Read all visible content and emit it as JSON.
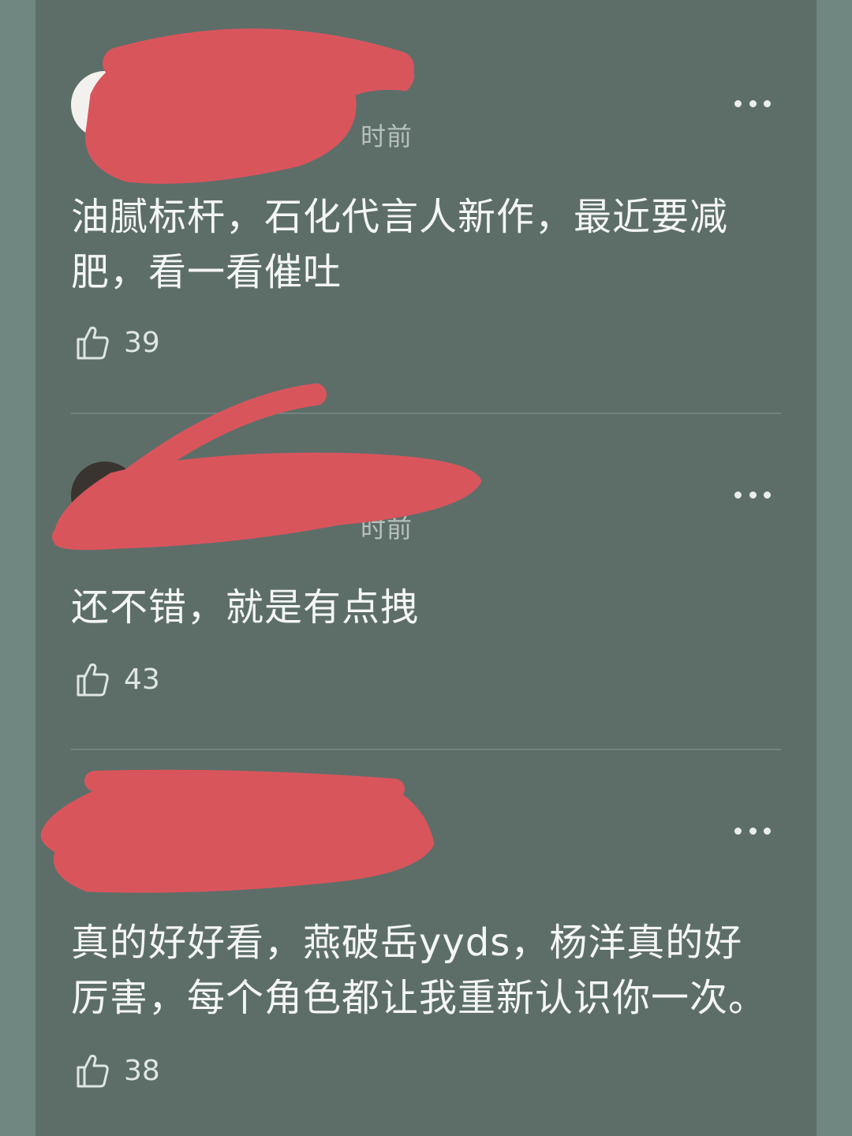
{
  "comments": [
    {
      "time_fragment": "时前",
      "text_line1": "油腻标杆，石化代言人新作，最近要减",
      "text_line2": "肥，看一看催吐",
      "likes": "39",
      "more_icon": "more-dots-icon",
      "like_icon": "thumbs-up-icon"
    },
    {
      "time_fragment": "时前",
      "text_line1": "还不错，就是有点拽",
      "text_line2": "",
      "likes": "43",
      "more_icon": "more-dots-icon",
      "like_icon": "thumbs-up-icon"
    },
    {
      "time_fragment": "",
      "text_line1": "真的好好看，燕破岳yyds，杨洋真的好",
      "text_line2": "厉害，每个角色都让我重新认识你一次。",
      "likes": "38",
      "more_icon": "more-dots-icon",
      "like_icon": "thumbs-up-icon"
    }
  ],
  "colors": {
    "panel": "#5d6e69",
    "outer": "#708681",
    "redaction": "#d9555c",
    "text": "#f4f6f5"
  }
}
